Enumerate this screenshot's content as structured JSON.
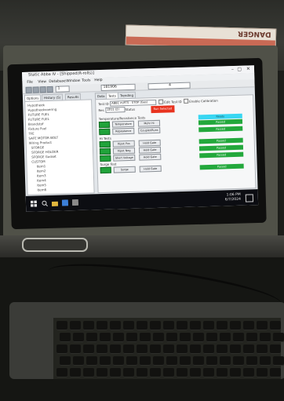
{
  "window": {
    "title": "Static Abba IV - [Shipped(R-rolls)]",
    "controls": [
      "–",
      "▢",
      "✕"
    ]
  },
  "menu": [
    "File",
    "View",
    "Database",
    "Window",
    "Tools",
    "Help"
  ],
  "toolbar": {
    "field_value": "181906",
    "counter_value": "1",
    "serial_value": "4",
    "buttons": [
      "new-icon",
      "open-icon",
      "save-icon",
      "print-icon"
    ]
  },
  "left_tabs": [
    {
      "label": "Options",
      "selected": true
    },
    {
      "label": "History (S)",
      "selected": false
    },
    {
      "label": "Results",
      "selected": false
    }
  ],
  "tree": [
    "Hypotheek",
    "Hypotheekvoering",
    "FUTURE FUEL",
    "FUTURE FUEL",
    "Brandstof",
    "Fixture Fuel",
    "TFE",
    "SAFE MOTOR BOLT",
    "Wiring Product",
    "SFORGE",
    "SFORGE HOLDER",
    "SFORGE Gasket",
    "CUSTOM",
    "Item1",
    "Item2",
    "Item3",
    "Item4",
    "Item5",
    "Item6"
  ],
  "content_tabs": [
    {
      "label": "Data",
      "selected": false
    },
    {
      "label": "Tests",
      "selected": true
    },
    {
      "label": "Trending",
      "selected": false
    }
  ],
  "test_panel": {
    "test_id_label": "Test ID",
    "test_id_value": "ABB1 m/FTS - STOP (Gas)",
    "edit_test_label": "Edit Test ID",
    "enable_calibration_label": "Enable Calibration",
    "run_label": "Res",
    "run_value": "2011 (2)",
    "status_label": "Status",
    "red_button_label": "Run Selected Tests",
    "section1": "Temperature/Resistance Tests",
    "row1_btn1": "Temperature",
    "row1_btn2": "Mohr Hi",
    "row2_btn1": "Repeatance",
    "row2_btn2": "Coupler/Runs",
    "section2": "Hi Tests",
    "row3_btn1": "Hipot Pos",
    "row3_btn2": "Hold Gate",
    "row4_btn1": "Hipot Neg",
    "row4_btn2": "Hold Gate",
    "row5_btn1": "Short Voltage",
    "row5_btn2": "Hold Gate",
    "section3": "Surge Test",
    "row6_btn1": "Surge",
    "row6_btn2": "Hold Gate",
    "status_bars": [
      {
        "label": "Ready",
        "color": "#38d6f2"
      },
      {
        "label": "Passed",
        "color": "#23a83c"
      },
      {
        "label": "Passed",
        "color": "#23a83c"
      },
      {
        "label": "Passed",
        "color": "#23a83c"
      },
      {
        "label": "Passed",
        "color": "#23a83c"
      },
      {
        "label": "Passed",
        "color": "#23a83c"
      },
      {
        "label": "Passed",
        "color": "#23a83c"
      }
    ]
  },
  "taskbar": {
    "time": "1:06 PM",
    "date": "6/7/2024"
  },
  "sticker": {
    "text": "DANGER"
  },
  "colors": {
    "red_button": "#e8331f",
    "green_indicator": "#20a33a",
    "cyan_status": "#38d6f2"
  }
}
